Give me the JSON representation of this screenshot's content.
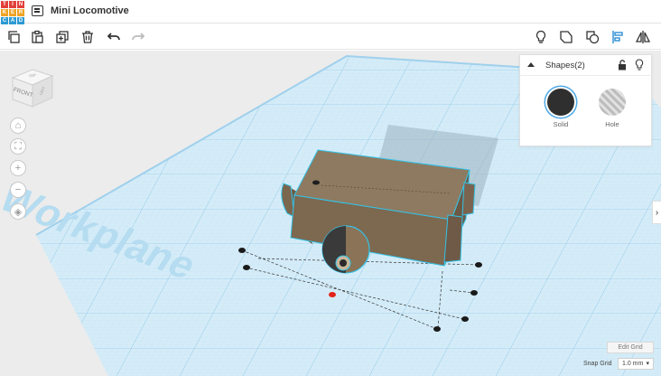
{
  "app": {
    "logo_letters": [
      "T",
      "I",
      "N",
      "K",
      "E",
      "R",
      "C",
      "A",
      "D"
    ],
    "logo_colors": [
      "#e2403a",
      "#e2403a",
      "#e2403a",
      "#f0a326",
      "#f0a326",
      "#f0a326",
      "#2d9ad3",
      "#2d9ad3",
      "#2d9ad3"
    ],
    "document_title": "Mini Locomotive"
  },
  "toolbar": {
    "left": [
      {
        "name": "copy-button",
        "icon": "copy-icon"
      },
      {
        "name": "paste-button",
        "icon": "paste-icon"
      },
      {
        "name": "duplicate-button",
        "icon": "duplicate-icon"
      },
      {
        "name": "delete-button",
        "icon": "trash-icon"
      },
      {
        "name": "undo-button",
        "icon": "undo-icon"
      },
      {
        "name": "redo-button",
        "icon": "redo-icon"
      }
    ],
    "right": [
      {
        "name": "toggle-visibility-button",
        "icon": "lightbulb-icon"
      },
      {
        "name": "group-button",
        "icon": "group-icon"
      },
      {
        "name": "ungroup-button",
        "icon": "ungroup-icon"
      },
      {
        "name": "align-button",
        "icon": "align-icon"
      },
      {
        "name": "mirror-button",
        "icon": "mirror-icon"
      }
    ]
  },
  "viewcube": {
    "front_label": "FRONT",
    "top_label": "TOP",
    "side_label": "LEFT"
  },
  "shapes_panel": {
    "title": "Shapes(2)",
    "solid_label": "Solid",
    "hole_label": "Hole"
  },
  "workplane": {
    "label": "Workplane"
  },
  "grid_controls": {
    "edit_grid_label": "Edit Grid",
    "snap_grid_label": "Snap Grid",
    "snap_grid_value": "1.0 mm"
  },
  "colors": {
    "accent": "#4fa9e6",
    "shape_body": "#8a7356",
    "grid": "#a9d6ef",
    "selection_outline": "#34c3e8"
  }
}
